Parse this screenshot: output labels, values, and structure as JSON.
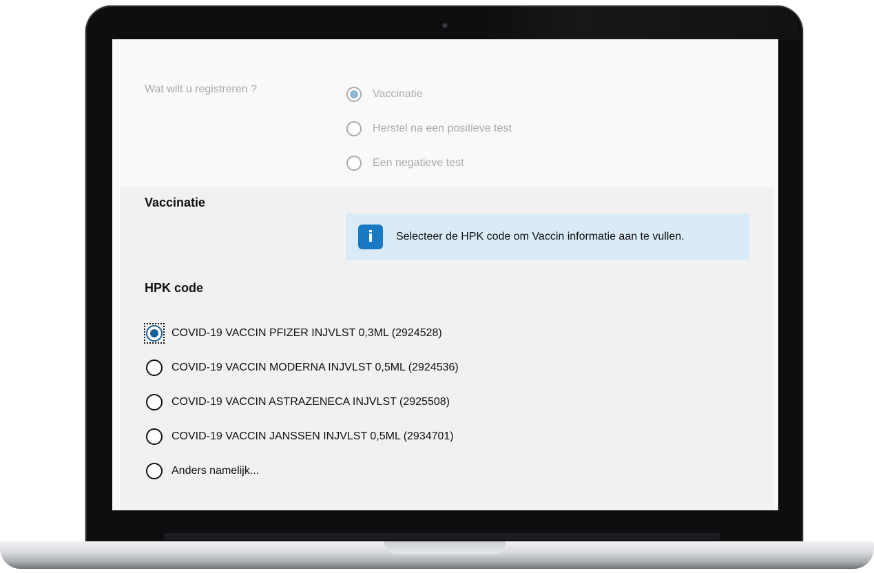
{
  "registration": {
    "question": "Wat wilt u registreren ?",
    "options": [
      {
        "label": "Vaccinatie",
        "checked": true
      },
      {
        "label": "Herstel na een positieve test",
        "checked": false
      },
      {
        "label": "Een negatieve test",
        "checked": false
      }
    ]
  },
  "vaccination": {
    "title": "Vaccinatie",
    "info_icon": "info-icon",
    "info_text": "Selecteer de HPK code om Vaccin informatie aan te vullen."
  },
  "hpk": {
    "title": "HPK code",
    "options": [
      {
        "label": "COVID-19 VACCIN PFIZER INJVLST 0,3ML (2924528)",
        "checked": true
      },
      {
        "label": "COVID-19 VACCIN MODERNA INJVLST 0,5ML (2924536)",
        "checked": false
      },
      {
        "label": "COVID-19 VACCIN ASTRAZENECA INJVLST (2925508)",
        "checked": false
      },
      {
        "label": "COVID-19 VACCIN JANSSEN INJVLST 0,5ML (2934701)",
        "checked": false
      },
      {
        "label": "Anders namelijk...",
        "checked": false
      }
    ]
  },
  "colors": {
    "accent": "#1a79c3",
    "info_background": "#d9ebf6",
    "section_background": "#f1f1f1",
    "disabled_text": "#a9a9a9"
  }
}
